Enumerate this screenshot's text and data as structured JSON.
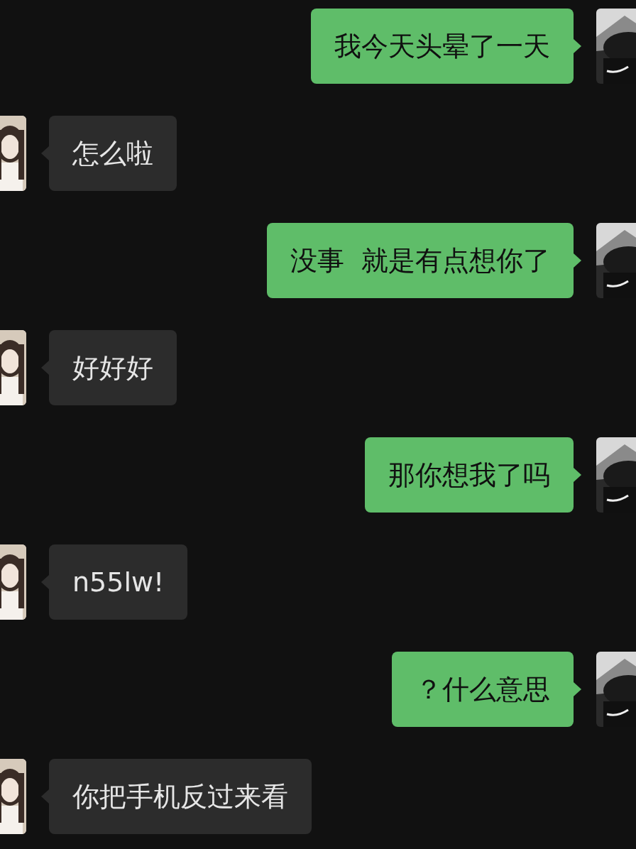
{
  "messages": [
    {
      "kind": "sent",
      "text": "我今天头晕了一天"
    },
    {
      "kind": "received",
      "text": "怎么啦"
    },
    {
      "kind": "sent",
      "text": "没事  就是有点想你了"
    },
    {
      "kind": "received",
      "text": "好好好"
    },
    {
      "kind": "sent",
      "text": "那你想我了吗"
    },
    {
      "kind": "received",
      "text": "n55lw!"
    },
    {
      "kind": "sent",
      "text": "？什么意思"
    },
    {
      "kind": "received",
      "text": "你把手机反过来看"
    }
  ]
}
